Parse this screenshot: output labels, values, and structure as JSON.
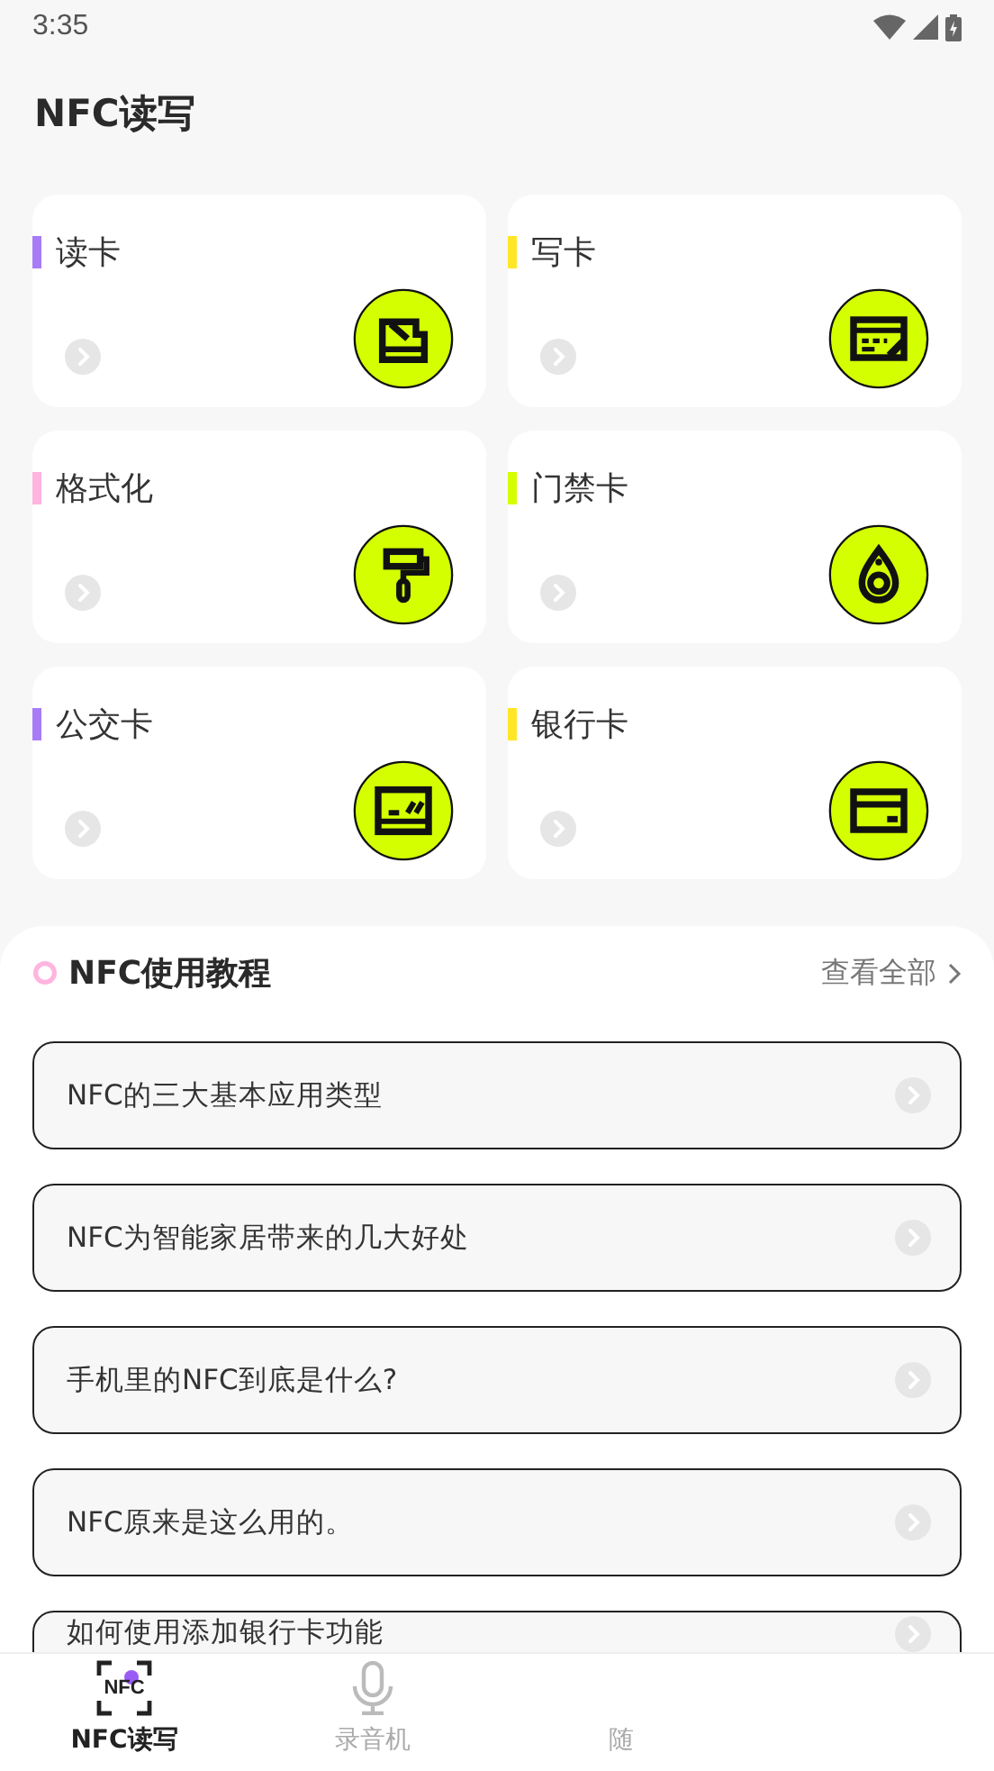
{
  "status_bar": {
    "time": "3:35"
  },
  "title": "NFC读写",
  "features": [
    {
      "label": "读卡",
      "color": "#a97cf7",
      "kind": "read"
    },
    {
      "label": "写卡",
      "color": "#ffe629",
      "kind": "write"
    },
    {
      "label": "格式化",
      "color": "#ffb5e0",
      "kind": "format"
    },
    {
      "label": "门禁卡",
      "color": "#d4ff00",
      "kind": "fob"
    },
    {
      "label": "公交卡",
      "color": "#a97cf7",
      "kind": "bus"
    },
    {
      "label": "银行卡",
      "color": "#ffe629",
      "kind": "bank"
    }
  ],
  "tutorials": {
    "title": "NFC使用教程",
    "more": "查看全部",
    "items": [
      "NFC的三大基本应用类型",
      "NFC为智能家居带来的几大好处",
      "手机里的NFC到底是什么?",
      "NFC原来是这么用的。",
      "如何使用添加银行卡功能"
    ]
  },
  "nav": [
    {
      "label": "NFC读写",
      "selected": true,
      "kind": "nfc",
      "icon_text": "NFC"
    },
    {
      "label": "录音机",
      "selected": false,
      "kind": "mic"
    },
    {
      "label": "随",
      "selected": false
    }
  ]
}
